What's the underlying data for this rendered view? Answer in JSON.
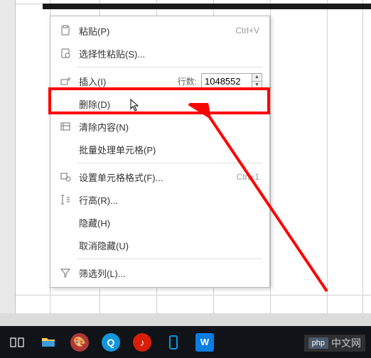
{
  "menu": {
    "paste": "粘贴(P)",
    "paste_shortcut": "Ctrl+V",
    "paste_special": "选择性粘贴(S)...",
    "insert": "插入(I)",
    "rows_label": "行数:",
    "rows_value": "1048552",
    "delete": "删除(D)",
    "clear_content": "清除内容(N)",
    "batch_cells": "批量处理单元格(P)",
    "format_cells": "设置单元格格式(F)...",
    "format_cells_shortcut": "Ctrl+1",
    "row_height": "行高(R)...",
    "hide": "隐藏(H)",
    "unhide": "取消隐藏(U)",
    "filter_column": "筛选列(L)..."
  },
  "watermark": {
    "logo": "php",
    "text": "中文网"
  }
}
